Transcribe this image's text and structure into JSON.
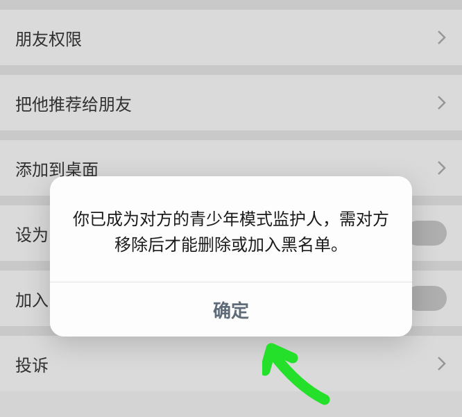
{
  "settings": {
    "items": [
      {
        "label": "朋友权限",
        "type": "chevron"
      },
      {
        "label": "把他推荐给朋友",
        "type": "chevron"
      },
      {
        "label": "添加到桌面",
        "type": "chevron"
      },
      {
        "label": "设为",
        "type": "toggle"
      },
      {
        "label": "加入",
        "type": "toggle"
      },
      {
        "label": "投诉",
        "type": "chevron"
      }
    ]
  },
  "modal": {
    "message": "你已成为对方的青少年模式监护人，需对方移除后才能删除或加入黑名单。",
    "confirm_label": "确定"
  },
  "colors": {
    "bg": "#d4d4d4",
    "item_bg": "#e5e5e5",
    "modal_bg": "#fdfdfd",
    "confirm_text": "#5f6b78",
    "annotation": "#24e02a"
  }
}
